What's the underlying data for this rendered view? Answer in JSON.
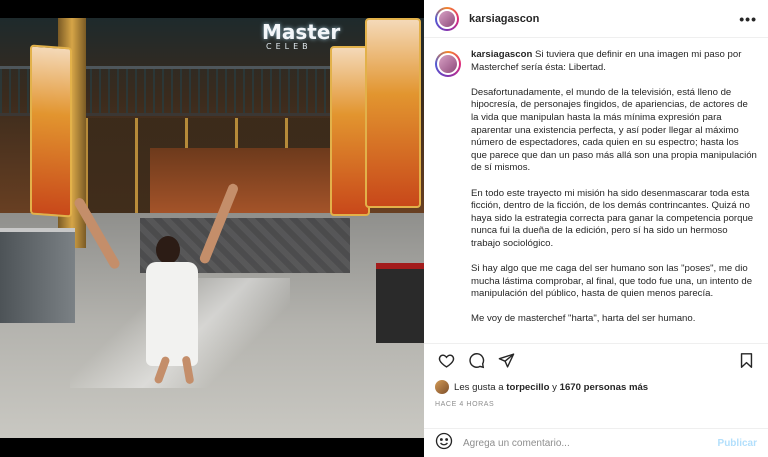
{
  "photo": {
    "sign_text": "Master",
    "sign_subtext": "CELEB"
  },
  "post": {
    "username": "karsiagascon",
    "caption_paragraphs": [
      "Si tuviera que definir en una imagen mi paso por Masterchef sería ésta: Libertad.",
      "Desafortunadamente, el mundo de la televisión, está lleno de hipocresía, de personajes fingidos, de apariencias, de actores de la vida que manipulan hasta la más mínima expresión para aparentar una existencia perfecta, y así poder llegar al máximo número de espectadores, cada quien en su espectro; hasta los que parece que dan un paso más allá son una propia manipulación de sí mismos.",
      "En todo este trayecto mi misión ha sido desenmascarar toda esta ficción, dentro de la ficción, de los demás contrincantes. Quizá no haya sido la estrategia correcta para ganar la competencia porque nunca fui la dueña de la edición, pero sí ha sido un hermoso trabajo sociológico.",
      "Si hay algo que me caga del ser humano son las \"poses\", me dio mucha lástima comprobar, al final, que todo fue una, un intento de manipulación del público, hasta de quien menos parecía.",
      "Me voy de masterchef \"harta\", harta del ser humano."
    ],
    "likes_prefix": "Les gusta a",
    "likes_user": "torpecillo",
    "likes_conjunction": "y",
    "likes_count": "1670 personas más",
    "timestamp": "HACE 4 HORAS",
    "comment_placeholder": "Agrega un comentario...",
    "publish_label": "Publicar"
  },
  "icons": {
    "more": "more-options-icon",
    "like": "heart-icon",
    "comment": "comment-bubble-icon",
    "share": "paper-plane-icon",
    "save": "bookmark-icon",
    "emoji": "emoji-smile-icon"
  },
  "colors": {
    "publish_disabled": "#b2dffc",
    "text": "#262626",
    "muted": "#8e8e8e"
  }
}
